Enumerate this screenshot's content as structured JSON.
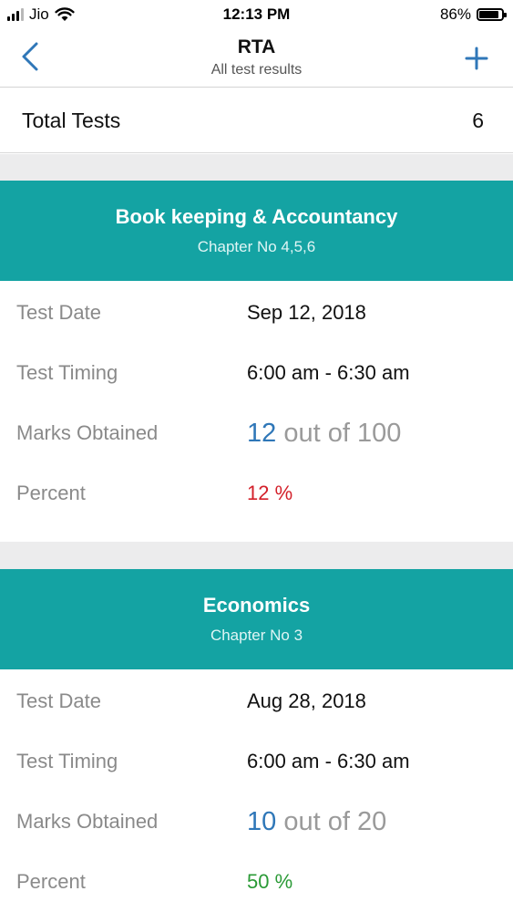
{
  "status_bar": {
    "carrier": "Jio",
    "time": "12:13 PM",
    "battery": "86%",
    "battery_level": 0.86
  },
  "nav": {
    "title": "RTA",
    "subtitle": "All test results",
    "back_icon": "chevron-left-icon",
    "add_icon": "plus-icon",
    "accent_color": "#2f77b8"
  },
  "summary": {
    "label": "Total Tests",
    "value": "6"
  },
  "labels": {
    "test_date": "Test Date",
    "test_timing": "Test Timing",
    "marks_obtained": "Marks Obtained",
    "percent": "Percent",
    "out_of": "out of"
  },
  "results": [
    {
      "subject": "Book keeping & Accountancy",
      "chapter": "Chapter No 4,5,6",
      "date": "Sep 12, 2018",
      "timing": "6:00 am - 6:30 am",
      "marks": "12",
      "total": "100",
      "percent": "12 %",
      "percent_color": "#d3202a"
    },
    {
      "subject": "Economics",
      "chapter": "Chapter No 3",
      "date": "Aug 28, 2018",
      "timing": "6:00 am - 6:30 am",
      "marks": "10",
      "total": "20",
      "percent": "50 %",
      "percent_color": "#2a9a36"
    }
  ],
  "colors": {
    "header_teal": "#14a3a3",
    "separator_gray": "#ececed"
  }
}
